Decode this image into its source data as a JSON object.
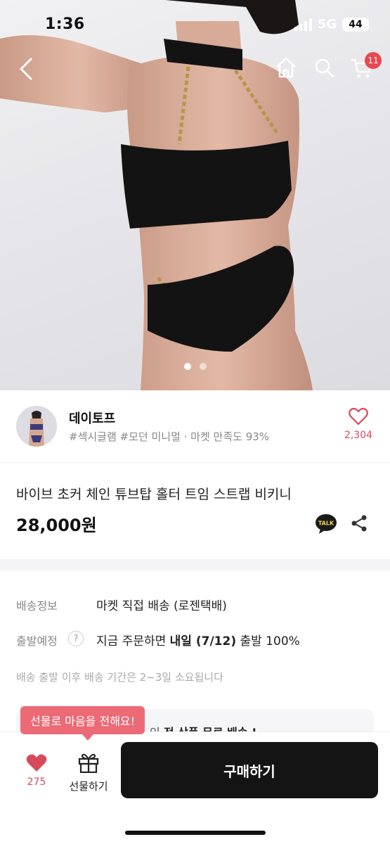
{
  "status_bar": {
    "time": "1:36",
    "network": "5G",
    "battery": "44"
  },
  "nav": {
    "cart_count": "11",
    "back_icon": "chevron-left-icon",
    "home_icon": "home-icon",
    "search_icon": "search-icon",
    "cart_icon": "cart-icon"
  },
  "carousel": {
    "total": 2,
    "active": 1
  },
  "seller": {
    "name": "데이토프",
    "tags": "#섹시글램 #모던 미니멀 · 마켓 만족도 93%",
    "likes": "2,304"
  },
  "product": {
    "title": "바이브 초커 체인 튜브탑 홀터 트임 스트랩 비키니",
    "price": "28,000원"
  },
  "talk_label": "TALK",
  "delivery": {
    "info_label": "배송정보",
    "info_value": "마켓 직접 배송 (로젠택배)",
    "departure_label": "출발예정",
    "help": "?",
    "departure_prefix": "지금 주문하면 ",
    "departure_bold": "내일 (7/12)",
    "departure_suffix": " 출발 100%",
    "note": "배송 출발 이후 배송 기간은 2~3일 소요됩니다"
  },
  "banner": {
    "prefix": "인 ",
    "bold": "전 상품 무료 배송 !"
  },
  "gift_tooltip": "선물로 마음을 전해요!",
  "bottom": {
    "wish_count": "275",
    "gift_label": "선물하기",
    "buy_label": "구매하기"
  },
  "colors": {
    "accent": "#d84a5b",
    "tooltip": "#ec6a75",
    "buy_button": "#141414"
  }
}
